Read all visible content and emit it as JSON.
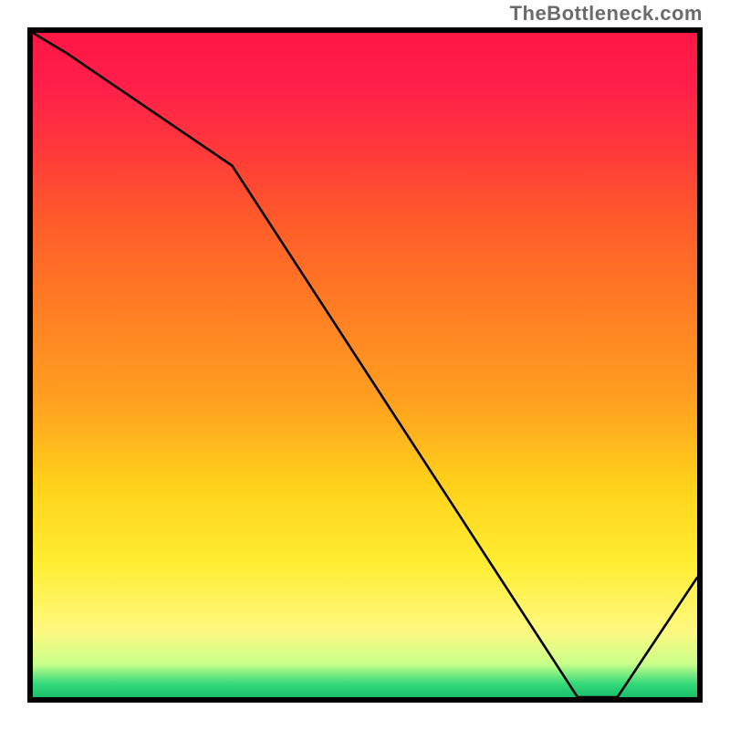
{
  "attribution": "TheBottleneck.com",
  "chart_data": {
    "type": "line",
    "title": "",
    "xlabel": "",
    "ylabel": "",
    "xlim": [
      0,
      100
    ],
    "ylim": [
      0,
      100
    ],
    "x": [
      0,
      5,
      30,
      82,
      88,
      100
    ],
    "values": [
      100,
      97,
      80,
      0,
      0,
      18
    ],
    "min_label": "",
    "min_label_x_pct": 80,
    "min_label_y_pct": 97.5,
    "gradient_stops": [
      {
        "pct": 0,
        "color": "#ff1744"
      },
      {
        "pct": 18,
        "color": "#ff3a3a"
      },
      {
        "pct": 40,
        "color": "#ff7a24"
      },
      {
        "pct": 68,
        "color": "#ffd11a"
      },
      {
        "pct": 90,
        "color": "#fff880"
      },
      {
        "pct": 100,
        "color": "#1abf6a"
      }
    ]
  }
}
